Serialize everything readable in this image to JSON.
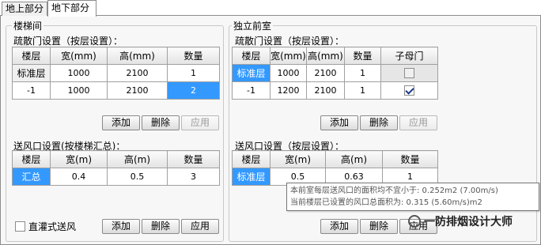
{
  "tabs": [
    {
      "label": "地上部分",
      "active": false
    },
    {
      "label": "地下部分",
      "active": true
    }
  ],
  "stair": {
    "group_title": "楼梯间",
    "door_title": "疏散门设置（按层设置）：",
    "door_headers": [
      "楼层",
      "宽(mm)",
      "高(mm)",
      "数量"
    ],
    "door_rows": [
      [
        "标准层",
        "1000",
        "2100",
        "1"
      ],
      [
        "-1",
        "1000",
        "2100",
        "2"
      ]
    ],
    "vent_title": "送风口设置(按楼梯汇总)：",
    "vent_headers": [
      "楼层",
      "宽(m)",
      "高(m)",
      "数量"
    ],
    "vent_rows": [
      [
        "汇总",
        "0.4",
        "0.5",
        "3"
      ]
    ],
    "direct_fan_label": "直灌式送风"
  },
  "antechamber": {
    "group_title": "独立前室",
    "door_title": "疏散门设置（按层设置）：",
    "door_headers": [
      "楼层",
      "宽(mm)",
      "高(mm)",
      "数量",
      "子母门"
    ],
    "door_rows": [
      [
        "标准层",
        "1000",
        "2100",
        "1"
      ],
      [
        "-1",
        "1200",
        "2100",
        "1"
      ]
    ],
    "vent_title": "送风口设置（按层设置）：",
    "vent_headers": [
      "楼层",
      "宽(m)",
      "高(m)",
      "数量"
    ],
    "vent_rows": [
      [
        "标准层",
        "0.5",
        "0.63",
        "1"
      ]
    ]
  },
  "buttons": {
    "add": "添加",
    "delete": "删除",
    "apply": "应用"
  },
  "tooltip": {
    "line1": "本前室每层送风口的面积均不宜小于: 0.252m2 (7.00m/s)",
    "line2": "当前楼层已设置的风口总面积为: 0.315 (5.60m/s)m2"
  },
  "watermark": "一防排烟设计大师"
}
